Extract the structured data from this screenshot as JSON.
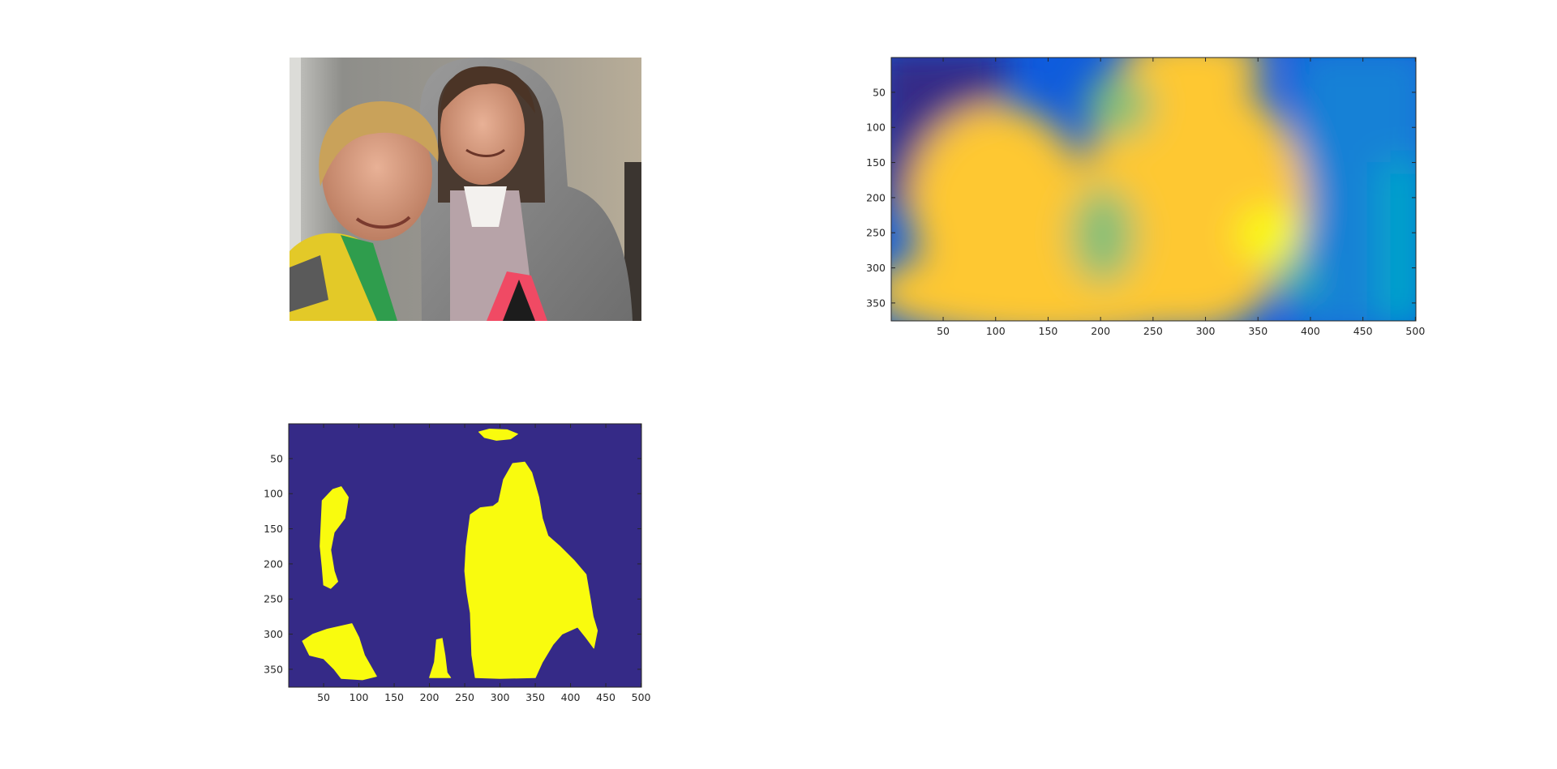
{
  "figure": {
    "background": "#ffffff",
    "layout": "2x2 subplot grid, bottom-right panel empty"
  },
  "chart_data": [
    {
      "type": "image",
      "panel": "top-left",
      "content": "photograph of two smiling young men, one blond on the left in a yellow jacket, one in a grey hoodie over a plaid shirt on the right",
      "axes_visible": false,
      "title": "",
      "xlabel": "",
      "ylabel": ""
    },
    {
      "type": "heatmap",
      "panel": "top-right",
      "colormap": "parula",
      "colormap_colors": [
        "#352a87",
        "#0f5cdd",
        "#1481d6",
        "#06a4ca",
        "#2eb7a4",
        "#87bf77",
        "#d1bb59",
        "#fec832",
        "#f9fb0e"
      ],
      "xlim": [
        0.5,
        500.5
      ],
      "ylim": [
        0.5,
        375.5
      ],
      "y_direction": "reverse",
      "xticks": [
        50,
        100,
        150,
        200,
        250,
        300,
        350,
        400,
        450,
        500
      ],
      "yticks": [
        50,
        100,
        150,
        200,
        250,
        300,
        350
      ],
      "description": "smooth saliency map: high values (yellow/orange) over the two faces and bodies, low values (blue) at the top-left and right edges",
      "title": "",
      "xlabel": "",
      "ylabel": ""
    },
    {
      "type": "heatmap",
      "panel": "bottom-left",
      "colormap": "parula (binary)",
      "colormap_colors": [
        "#352a87",
        "#f9fb0e"
      ],
      "values": [
        0,
        1
      ],
      "xlim": [
        0.5,
        500.5
      ],
      "ylim": [
        0.5,
        375.5
      ],
      "y_direction": "reverse",
      "xticks": [
        50,
        100,
        150,
        200,
        250,
        300,
        350,
        400,
        450,
        500
      ],
      "yticks": [
        50,
        100,
        150,
        200,
        250,
        300,
        350
      ],
      "regions": [
        {
          "name": "top-small",
          "polygon": [
            [
              270,
              12
            ],
            [
              285,
              8
            ],
            [
              310,
              9
            ],
            [
              325,
              15
            ],
            [
              315,
              22
            ],
            [
              295,
              24
            ],
            [
              278,
              20
            ]
          ]
        },
        {
          "name": "left-head",
          "polygon": [
            [
              48,
              110
            ],
            [
              63,
              94
            ],
            [
              75,
              90
            ],
            [
              85,
              105
            ],
            [
              80,
              135
            ],
            [
              65,
              155
            ],
            [
              60,
              180
            ],
            [
              65,
              210
            ],
            [
              70,
              225
            ],
            [
              60,
              235
            ],
            [
              50,
              230
            ],
            [
              48,
              205
            ],
            [
              45,
              175
            ]
          ]
        },
        {
          "name": "bottom-left",
          "polygon": [
            [
              20,
              310
            ],
            [
              35,
              300
            ],
            [
              55,
              293
            ],
            [
              90,
              285
            ],
            [
              100,
              305
            ],
            [
              108,
              330
            ],
            [
              125,
              360
            ],
            [
              105,
              365
            ],
            [
              75,
              363
            ],
            [
              65,
              350
            ],
            [
              50,
              335
            ],
            [
              30,
              330
            ]
          ]
        },
        {
          "name": "bottom-small",
          "polygon": [
            [
              200,
              362
            ],
            [
              207,
              340
            ],
            [
              210,
              308
            ],
            [
              218,
              306
            ],
            [
              222,
              330
            ],
            [
              225,
              355
            ],
            [
              230,
              362
            ]
          ]
        },
        {
          "name": "right-figure",
          "polygon": [
            [
              258,
              130
            ],
            [
              272,
              120
            ],
            [
              290,
              118
            ],
            [
              298,
              112
            ],
            [
              305,
              80
            ],
            [
              318,
              57
            ],
            [
              335,
              55
            ],
            [
              345,
              70
            ],
            [
              355,
              105
            ],
            [
              360,
              135
            ],
            [
              368,
              160
            ],
            [
              385,
              175
            ],
            [
              405,
              195
            ],
            [
              422,
              215
            ],
            [
              428,
              250
            ],
            [
              432,
              275
            ],
            [
              438,
              295
            ],
            [
              433,
              320
            ],
            [
              422,
              305
            ],
            [
              410,
              290
            ],
            [
              388,
              300
            ],
            [
              375,
              315
            ],
            [
              360,
              340
            ],
            [
              350,
              362
            ],
            [
              300,
              363
            ],
            [
              265,
              362
            ],
            [
              260,
              330
            ],
            [
              258,
              270
            ],
            [
              253,
              240
            ],
            [
              250,
              210
            ],
            [
              252,
              175
            ]
          ]
        }
      ],
      "title": "",
      "xlabel": "",
      "ylabel": ""
    }
  ]
}
